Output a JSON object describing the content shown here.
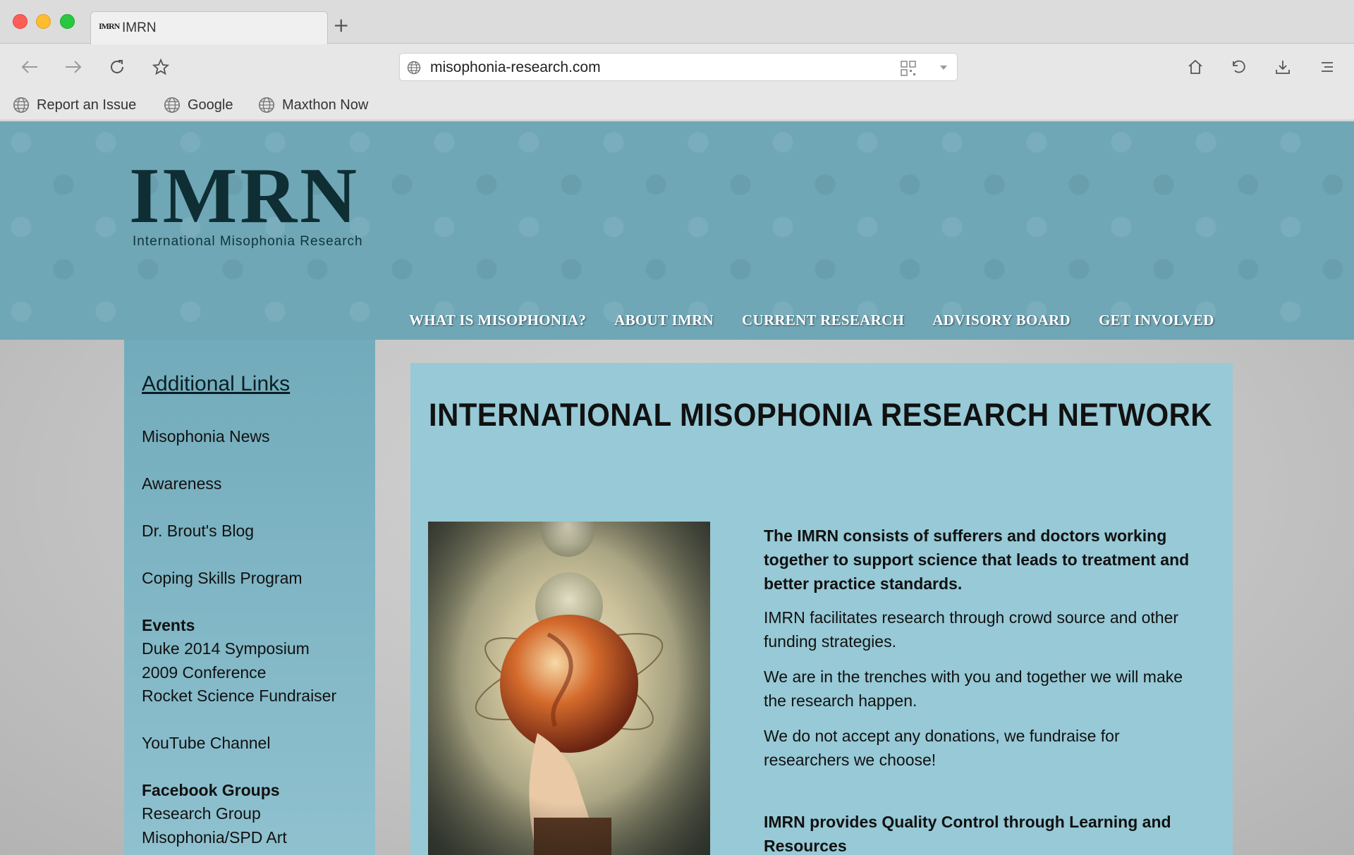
{
  "browser": {
    "tab_title": "IMRN",
    "tab_favicon_text": "IMRN",
    "new_tab_label": "+",
    "url": "misophonia-research.com",
    "bookmarks": [
      {
        "label": "Report an Issue",
        "icon": "globe-icon"
      },
      {
        "label": "Google",
        "icon": "globe-icon"
      },
      {
        "label": "Maxthon Now",
        "icon": "globe-icon"
      }
    ]
  },
  "site": {
    "logo": {
      "main": "IMRN",
      "sub": "International Misophonia Research"
    },
    "nav": [
      "WHAT IS MISOPHONIA?",
      "ABOUT IMRN",
      "CURRENT RESEARCH",
      "ADVISORY BOARD",
      "GET INVOLVED"
    ],
    "sidebar": {
      "heading": "Additional Links",
      "links": [
        "Misophonia News",
        "Awareness",
        "Dr. Brout's Blog",
        "Coping Skills Program"
      ],
      "events_heading": "Events",
      "events": [
        "Duke 2014 Symposium",
        "2009 Conference",
        "Rocket Science Fundraiser"
      ],
      "youtube": "YouTube Channel",
      "facebook_heading": "Facebook Groups",
      "facebook": [
        "Research Group",
        "Misophonia/SPD Art"
      ]
    },
    "main": {
      "title": "INTERNATIONAL MISOPHONIA RESEARCH NETWORK",
      "lead": "The IMRN consists of sufferers and doctors working together to support science that leads to treatment and better practice standards.",
      "paragraphs": [
        "IMRN  facilitates research through crowd source and other funding strategies.",
        "We are in the trenches with you and together we will make the research happen.",
        "We do not accept any donations, we fundraise for researchers we choose!"
      ],
      "lead2": "IMRN provides Quality Control through Learning and Resources"
    }
  }
}
